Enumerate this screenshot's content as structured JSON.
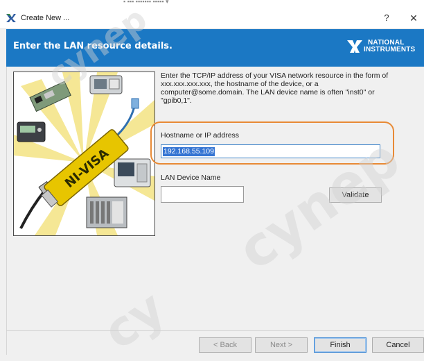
{
  "window": {
    "title": "Create New ...",
    "help_label": "?",
    "close_label": "✕"
  },
  "banner": {
    "title": "Enter the LAN resource details.",
    "brand_line1": "NATIONAL",
    "brand_line2": "INSTRUMENTS",
    "color": "#1b78c4"
  },
  "illustration": {
    "product_label": "NI-VISA"
  },
  "form": {
    "description": "Enter the TCP/IP address of your VISA network resource in the form of xxx.xxx.xxx.xxx, the hostname of the device, or a computer@some.domain. The LAN device name is often \"inst0\" or \"gpib0,1\".",
    "host_label": "Hostname or IP address",
    "host_value": "192.168.55.109",
    "device_label": "LAN Device Name",
    "device_value": "",
    "validate_label": "Validate"
  },
  "footer": {
    "back_label": "< Back",
    "next_label": "Next >",
    "finish_label": "Finish",
    "cancel_label": "Cancel"
  },
  "watermark": {
    "text_large": "cynep",
    "text_small": "cynep",
    "text_bottom": "cy"
  },
  "colors": {
    "accent": "#3575d3",
    "highlight": "#e88a35"
  }
}
